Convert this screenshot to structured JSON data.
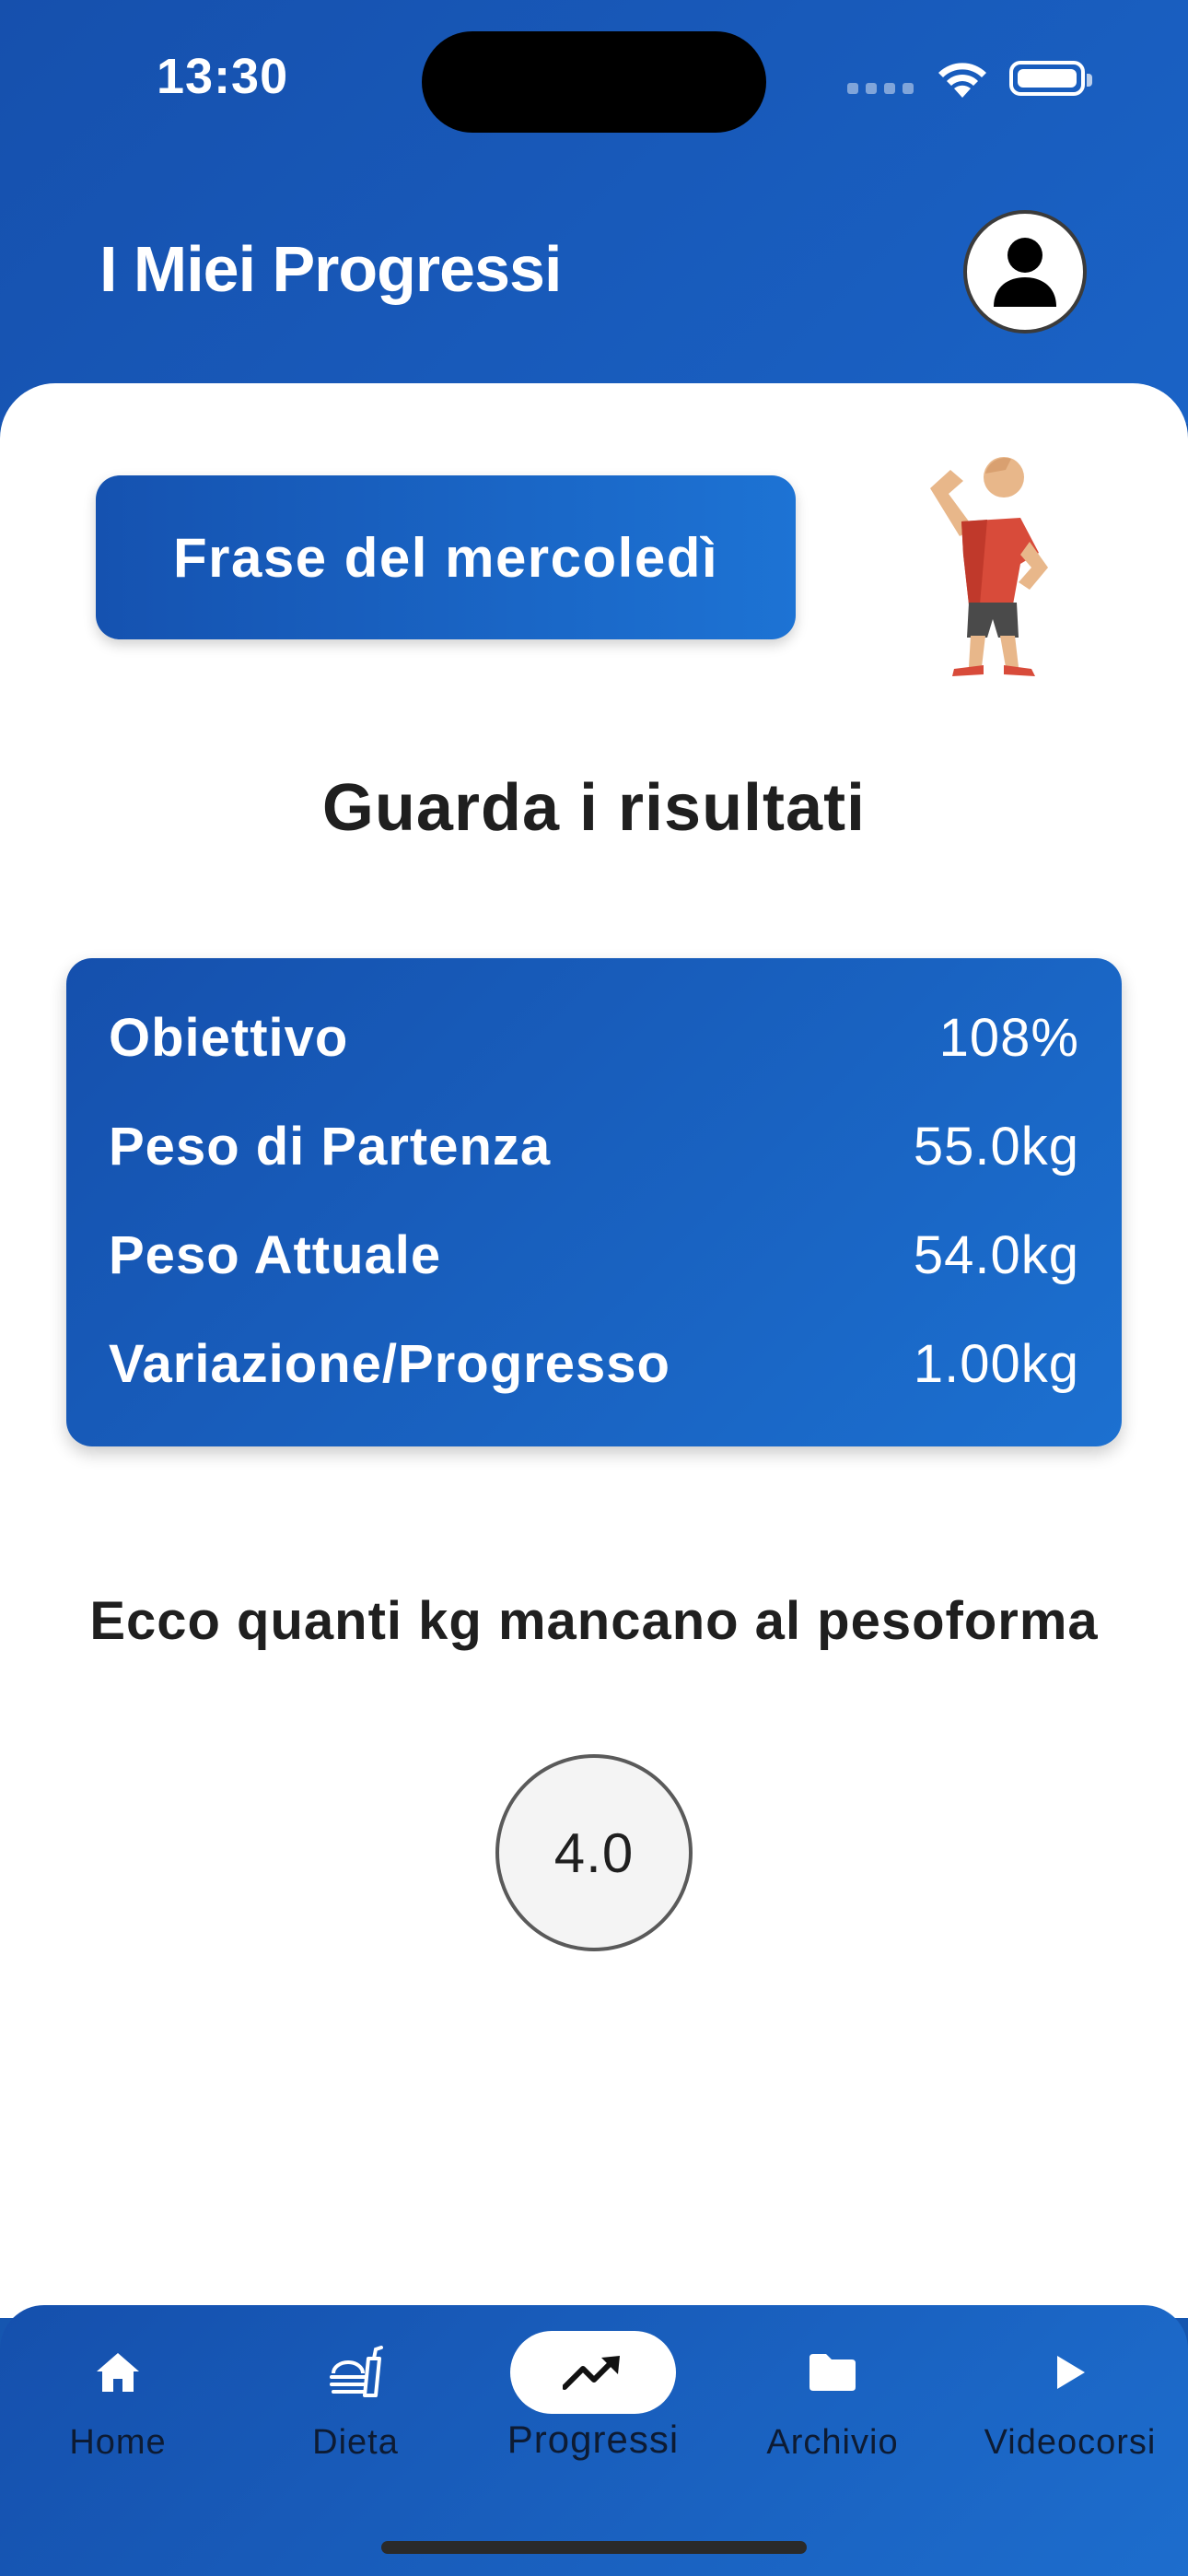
{
  "status_bar": {
    "time": "13:30"
  },
  "header": {
    "title": "I Miei Progressi"
  },
  "quote_button": {
    "label": "Frase del mercoledì"
  },
  "results": {
    "title": "Guarda i risultati",
    "rows": [
      {
        "label": "Obiettivo",
        "value": "108%"
      },
      {
        "label": "Peso di Partenza",
        "value": "55.0kg"
      },
      {
        "label": "Peso Attuale",
        "value": "54.0kg"
      },
      {
        "label": "Variazione/Progresso",
        "value": "1.00kg"
      }
    ]
  },
  "remaining": {
    "subtitle": "Ecco quanti kg mancano al pesoforma",
    "value": "4.0"
  },
  "bottom_nav": {
    "items": [
      {
        "label": "Home",
        "icon": "home-icon"
      },
      {
        "label": "Dieta",
        "icon": "diet-icon"
      },
      {
        "label": "Progressi",
        "icon": "trending-up-icon",
        "active": true
      },
      {
        "label": "Archivio",
        "icon": "folder-icon"
      },
      {
        "label": "Videocorsi",
        "icon": "play-icon"
      }
    ]
  },
  "colors": {
    "primary": "#1650ad",
    "primary_light": "#1d6dcd",
    "text_dark": "#1f1f1f"
  }
}
